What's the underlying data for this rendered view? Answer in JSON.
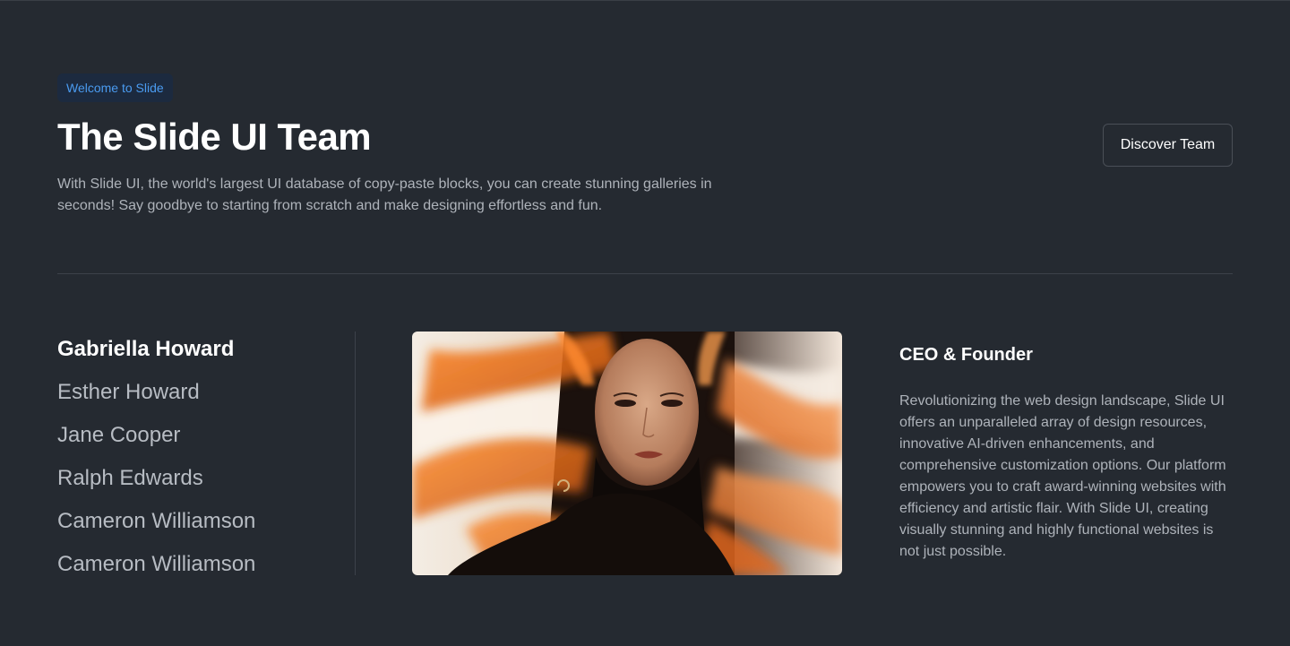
{
  "header": {
    "badge": "Welcome to Slide",
    "title": "The Slide UI Team",
    "subtitle": "With Slide UI, the world's largest UI database of copy-paste blocks, you can create stunning galleries in seconds! Say goodbye to starting from scratch and make designing effortless and fun.",
    "cta_label": "Discover Team"
  },
  "team": {
    "members": [
      {
        "name": "Gabriella Howard",
        "active": true
      },
      {
        "name": "Esther Howard",
        "active": false
      },
      {
        "name": "Jane Cooper",
        "active": false
      },
      {
        "name": "Ralph Edwards",
        "active": false
      },
      {
        "name": "Cameron Williamson",
        "active": false
      },
      {
        "name": "Cameron Williamson",
        "active": false
      }
    ],
    "selected": {
      "role": "CEO & Founder",
      "bio": "Revolutionizing the web design landscape, Slide UI offers an unparalleled array of design resources, innovative AI-driven enhancements, and comprehensive customization options. Our platform empowers you to craft award-winning websites with efficiency and artistic flair. With Slide UI, creating visually stunning and highly functional websites is not just possible."
    }
  },
  "colors": {
    "background": "#252a31",
    "accent": "#4a9bf0",
    "badge_bg": "#1c2a3f",
    "muted_text": "#aeb3ba",
    "divider": "#3d424a"
  }
}
